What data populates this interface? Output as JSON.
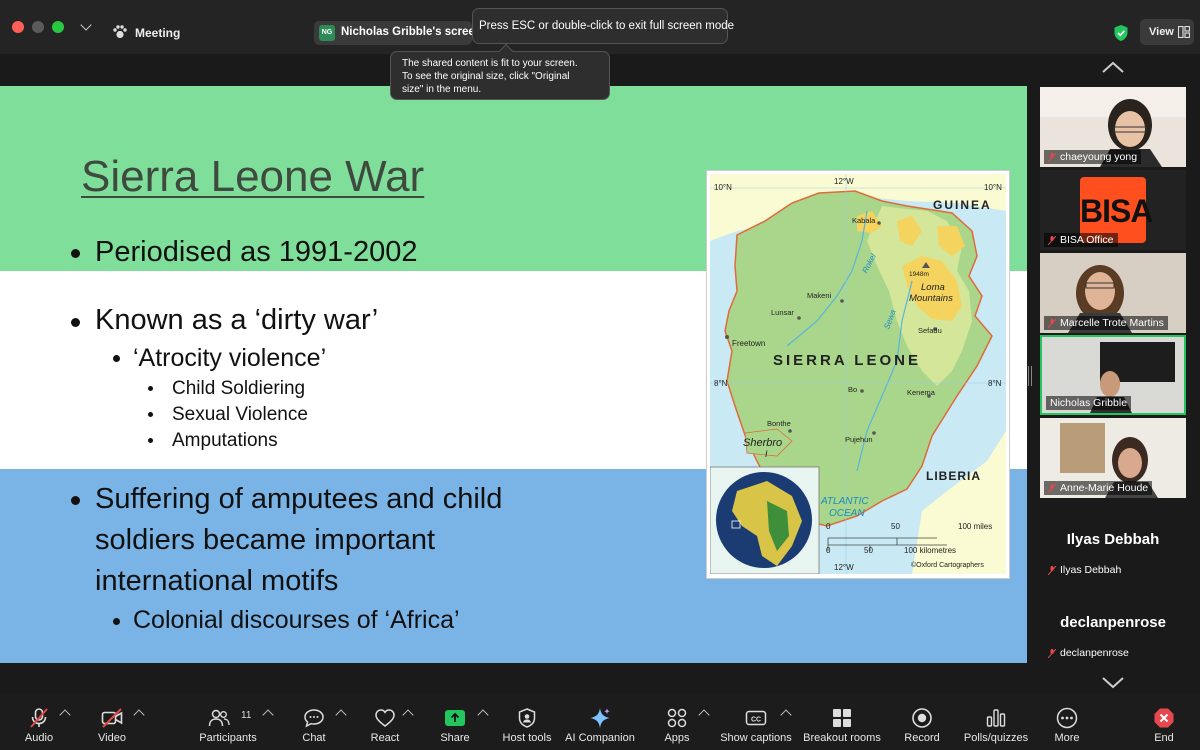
{
  "titlebar": {
    "meeting_label": "Meeting",
    "share_tab_badge": "NG",
    "share_tab_label": "Nicholas Gribble's screen",
    "esc_tooltip": "Press ESC or double-click to exit full screen mode",
    "view_label": "View"
  },
  "fit_tooltip": {
    "line1": "The shared content is fit to your screen.",
    "line2": "To see the original size, click \"Original",
    "line3": "size\" in the menu."
  },
  "slide": {
    "title": "Sierra Leone War",
    "bullet1": "Periodised as 1991-2002",
    "bullet2": "Known as a ‘dirty war’",
    "bullet2_sub": "‘Atrocity violence’",
    "bullet2_subsub": [
      "Child Soldiering",
      "Sexual Violence",
      "Amputations"
    ],
    "bullet3_lines": [
      "Suffering of amputees and child",
      "soldiers became important",
      "international motifs"
    ],
    "bullet3_sub": "Colonial discourses of ‘Africa’",
    "colors": {
      "green": "#7fdf9a",
      "white": "#ffffff",
      "blue": "#7ab3e6"
    }
  },
  "map": {
    "lat_top_left": "10°N",
    "lat_top_right": "10°N",
    "lon_top": "12°W",
    "lon_bottom": "12°W",
    "lat_mid_left": "8°N",
    "lat_mid_right": "8°N",
    "country": "SIERRA LEONE",
    "neighbor_north": "GUINEA",
    "neighbor_south": "LIBERIA",
    "ocean": [
      "ATLANTIC",
      "OCEAN"
    ],
    "towns": {
      "kabala": "Kabala",
      "makeni": "Makeni",
      "lunsar": "Lunsar",
      "freetown": "Freetown",
      "bo": "Bo",
      "kenema": "Kenema",
      "bonthe": "Bonthe",
      "pujehun": "Pujehun",
      "sefadu": "Sefadu"
    },
    "rivers": {
      "rokel": "Rokel",
      "sewa": "Sewa"
    },
    "elevation": "1948m",
    "mountains": [
      "Loma",
      "Mountains"
    ],
    "island": [
      "Sherbro",
      "I"
    ],
    "scale_miles": {
      "zero": "0",
      "mid": "50",
      "end": "100 miles"
    },
    "scale_km": {
      "zero": "0",
      "mid": "50",
      "end": "100 kilometres"
    },
    "credit": "©Oxford Cartographers"
  },
  "participants": [
    {
      "name": "chaeyoung yong",
      "muted": true
    },
    {
      "name": "BISA Office",
      "muted": true,
      "logo": "BISA"
    },
    {
      "name": "Marcelle Trote Martins",
      "muted": true
    },
    {
      "name": "Nicholas Gribble",
      "muted": false,
      "active": true
    },
    {
      "name": "Anne-Marie Houde",
      "muted": true
    },
    {
      "name": "Ilyas Debbah",
      "muted": true,
      "video_off": true
    },
    {
      "name": "declanpenrose",
      "muted": true,
      "video_off": true
    }
  ],
  "toolbar": {
    "audio": "Audio",
    "video": "Video",
    "participants": "Participants",
    "participants_count": "11",
    "chat": "Chat",
    "react": "React",
    "share": "Share",
    "host_tools": "Host tools",
    "ai_companion": "AI Companion",
    "apps": "Apps",
    "captions": "Show captions",
    "breakout": "Breakout rooms",
    "record": "Record",
    "polls": "Polls/quizzes",
    "more": "More",
    "end": "End",
    "share_color": "#22c55e",
    "end_color": "#e5484d"
  }
}
